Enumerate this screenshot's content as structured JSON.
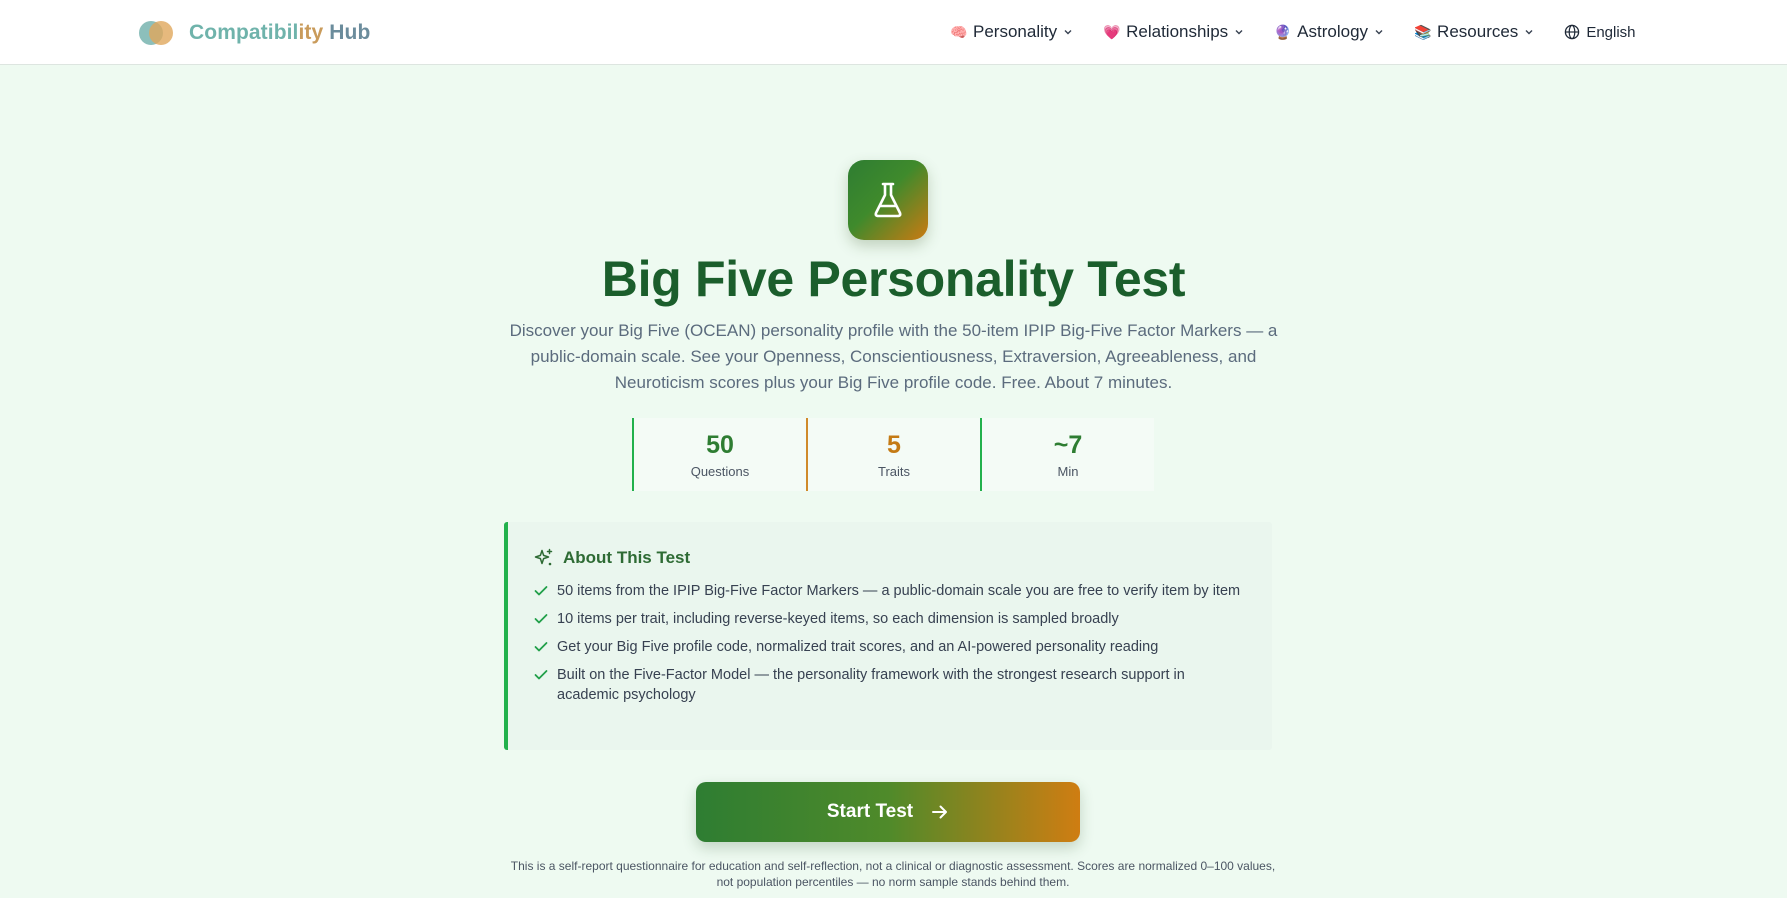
{
  "header": {
    "logo": {
      "part1": "Compatibil",
      "part2": "ity",
      "part3": " Hub"
    },
    "nav": [
      {
        "icon": "brain-icon",
        "emoji": "🧠",
        "label": "Personality"
      },
      {
        "icon": "heart-icon",
        "emoji": "💗",
        "label": "Relationships"
      },
      {
        "icon": "crystal-ball-icon",
        "emoji": "🔮",
        "label": "Astrology"
      },
      {
        "icon": "books-icon",
        "emoji": "📚",
        "label": "Resources"
      }
    ],
    "language": "English"
  },
  "hero": {
    "icon": "flask-icon",
    "title": "Big Five Personality Test",
    "subtitle": "Discover your Big Five (OCEAN) personality profile with the 50-item IPIP Big-Five Factor Markers — a public-domain scale. See your Openness, Conscientiousness, Extraversion, Agreeableness, and Neuroticism scores plus your Big Five profile code. Free. About 7 minutes."
  },
  "stats": [
    {
      "value": "50",
      "label": "Questions"
    },
    {
      "value": "5",
      "label": "Traits"
    },
    {
      "value": "~7",
      "label": "Min"
    }
  ],
  "about": {
    "heading": "About This Test",
    "items": [
      "50 items from the IPIP Big-Five Factor Markers — a public-domain scale you are free to verify item by item",
      "10 items per trait, including reverse-keyed items, so each dimension is sampled broadly",
      "Get your Big Five profile code, normalized trait scores, and an AI-powered personality reading",
      "Built on the Five-Factor Model — the personality framework with the strongest research support in academic psychology"
    ]
  },
  "cta": {
    "label": "Start Test"
  },
  "disclaimer": "This is a self-report questionnaire for education and self-reflection, not a clinical or diagnostic assessment. Scores are normalized 0–100 values, not population percentiles — no norm sample stands behind them.",
  "colors": {
    "primary": "#2e7d32",
    "accent": "#cc7a12",
    "title": "#1b5e2c",
    "background": "#eefaf1"
  }
}
